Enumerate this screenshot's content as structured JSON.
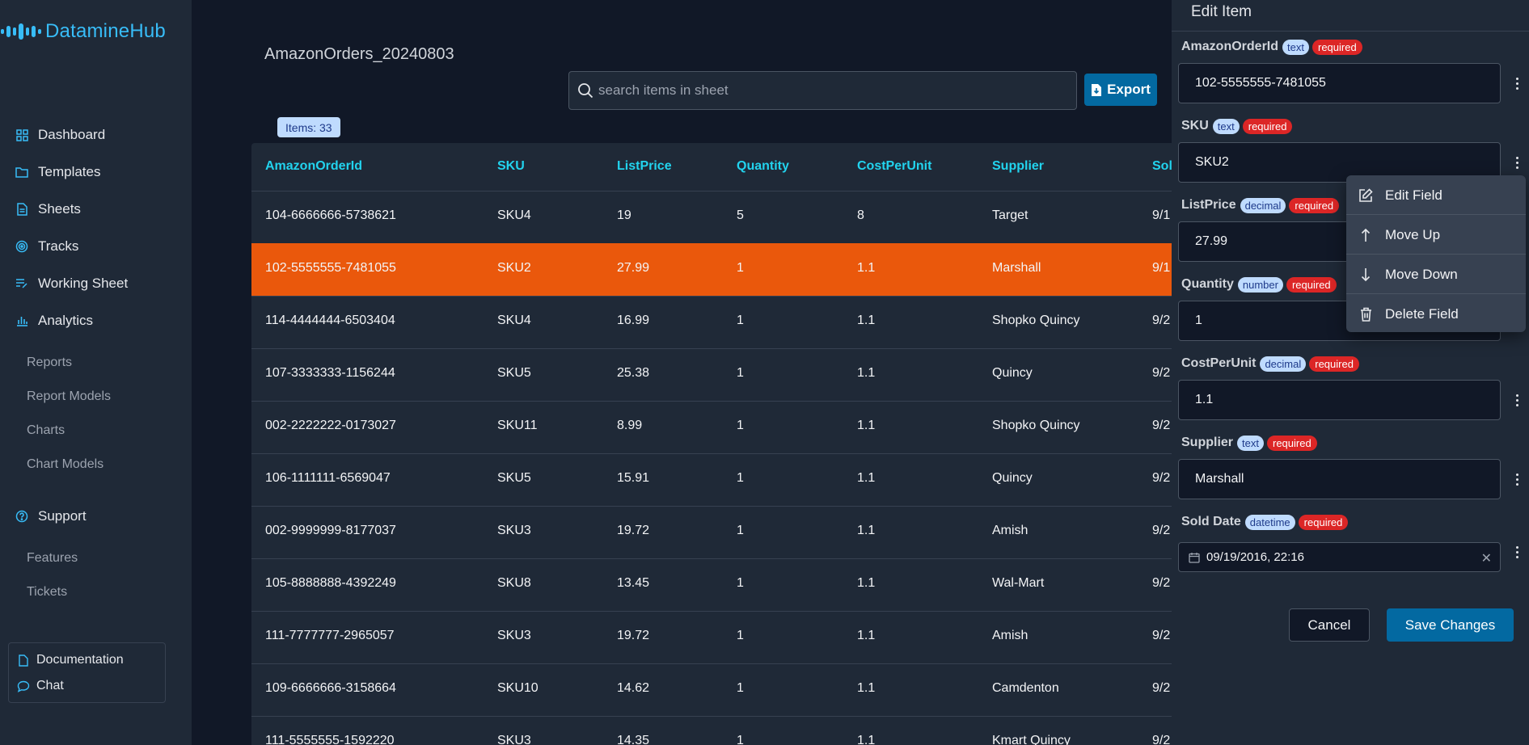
{
  "app": {
    "name": "DatamineHub",
    "accent": "#38bdf8"
  },
  "sidebar": {
    "nav": [
      {
        "label": "Dashboard",
        "icon": "grid-icon"
      },
      {
        "label": "Templates",
        "icon": "folder-icon"
      },
      {
        "label": "Sheets",
        "icon": "file-icon"
      },
      {
        "label": "Tracks",
        "icon": "target-icon"
      },
      {
        "label": "Working Sheet",
        "icon": "list-edit-icon"
      },
      {
        "label": "Analytics",
        "icon": "bar-chart-icon"
      }
    ],
    "analytics_items": [
      "Reports",
      "Report Models",
      "Charts",
      "Chart Models"
    ],
    "support": {
      "label": "Support",
      "icon": "help-circle-icon"
    },
    "support_items": [
      "Features",
      "Tickets"
    ],
    "documentation": "Documentation",
    "chat": "Chat"
  },
  "main": {
    "sheet_title": "AmazonOrders_20240803",
    "search_placeholder": "search items in sheet",
    "export_label": "Export",
    "items_badge": "Items: 33"
  },
  "table": {
    "columns": [
      "AmazonOrderId",
      "SKU",
      "ListPrice",
      "Quantity",
      "CostPerUnit",
      "Supplier",
      "Sol"
    ],
    "selected_row": 1,
    "selected_color": "#ea580c",
    "rows": [
      [
        "104-6666666-5738621",
        "SKU4",
        "19",
        "5",
        "8",
        "Target",
        "9/1"
      ],
      [
        "102-5555555-7481055",
        "SKU2",
        "27.99",
        "1",
        "1.1",
        "Marshall",
        "9/1"
      ],
      [
        "114-4444444-6503404",
        "SKU4",
        "16.99",
        "1",
        "1.1",
        "Shopko Quincy",
        "9/2"
      ],
      [
        "107-3333333-1156244",
        "SKU5",
        "25.38",
        "1",
        "1.1",
        "Quincy",
        "9/2"
      ],
      [
        "002-2222222-0173027",
        "SKU11",
        "8.99",
        "1",
        "1.1",
        "Shopko Quincy",
        "9/2"
      ],
      [
        "106-1111111-6569047",
        "SKU5",
        "15.91",
        "1",
        "1.1",
        "Quincy",
        "9/2"
      ],
      [
        "002-9999999-8177037",
        "SKU3",
        "19.72",
        "1",
        "1.1",
        "Amish",
        "9/2"
      ],
      [
        "105-8888888-4392249",
        "SKU8",
        "13.45",
        "1",
        "1.1",
        "Wal-Mart",
        "9/2"
      ],
      [
        "111-7777777-2965057",
        "SKU3",
        "19.72",
        "1",
        "1.1",
        "Amish",
        "9/2"
      ],
      [
        "109-6666666-3158664",
        "SKU10",
        "14.62",
        "1",
        "1.1",
        "Camdenton",
        "9/2"
      ],
      [
        "111-5555555-1592220",
        "SKU3",
        "14.35",
        "1",
        "1.1",
        "Kmart Quincy",
        "9/2"
      ]
    ]
  },
  "edit_panel": {
    "title": "Edit Item",
    "fields": [
      {
        "name": "AmazonOrderId",
        "type": "text",
        "required": "required",
        "value": "102-5555555-7481055"
      },
      {
        "name": "SKU",
        "type": "text",
        "required": "required",
        "value": "SKU2"
      },
      {
        "name": "ListPrice",
        "type": "decimal",
        "required": "required",
        "value": "27.99"
      },
      {
        "name": "Quantity",
        "type": "number",
        "required": "required",
        "value": "1"
      },
      {
        "name": "CostPerUnit",
        "type": "decimal",
        "required": "required",
        "value": "1.1"
      },
      {
        "name": "Supplier",
        "type": "text",
        "required": "required",
        "value": "Marshall"
      },
      {
        "name": "Sold Date",
        "type": "datetime",
        "required": "required",
        "value": "09/19/2016, 22:16"
      }
    ],
    "cancel_label": "Cancel",
    "save_label": "Save Changes"
  },
  "context_menu": {
    "items": [
      {
        "label": "Edit Field",
        "icon": "edit-icon"
      },
      {
        "label": "Move Up",
        "icon": "arrow-up-icon"
      },
      {
        "label": "Move Down",
        "icon": "arrow-down-icon"
      },
      {
        "label": "Delete Field",
        "icon": "trash-icon"
      }
    ]
  }
}
